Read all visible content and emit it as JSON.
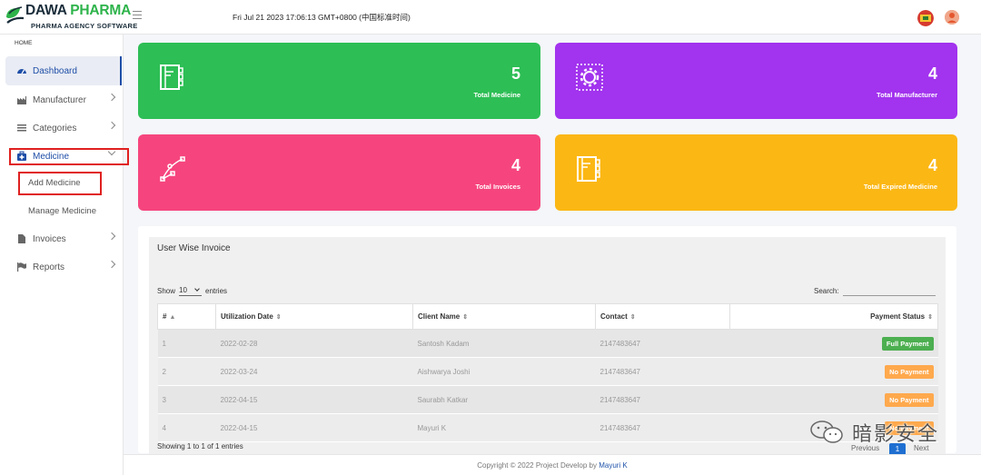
{
  "header": {
    "brand_main": "DAWA",
    "brand_accent": "PHARMA",
    "brand_sub": "PHARMA AGENCY SOFTWARE",
    "datetime": "Fri Jul 21 2023 17:06:13 GMT+0800 (中国标准时间)"
  },
  "sidebar": {
    "home_label": "HOME",
    "items": [
      {
        "label": "Dashboard",
        "icon": "dashboard-icon"
      },
      {
        "label": "Manufacturer",
        "icon": "factory-icon"
      },
      {
        "label": "Categories",
        "icon": "list-icon"
      },
      {
        "label": "Medicine",
        "icon": "medkit-icon"
      },
      {
        "label": "Invoices",
        "icon": "file-icon"
      },
      {
        "label": "Reports",
        "icon": "flag-icon"
      }
    ],
    "medicine_sub": [
      "Add Medicine",
      "Manage Medicine"
    ]
  },
  "cards": [
    {
      "value": "5",
      "label": "Total Medicine",
      "color": "#2dbe55",
      "icon": "notebook-icon"
    },
    {
      "value": "4",
      "label": "Total Manufacturer",
      "color": "#a233ee",
      "icon": "gear-icon"
    },
    {
      "value": "4",
      "label": "Total Invoices",
      "color": "#f6457e",
      "icon": "vector-icon"
    },
    {
      "value": "4",
      "label": "Total Expired Medicine",
      "color": "#fbb714",
      "icon": "notebook-icon"
    }
  ],
  "invoice_table": {
    "title": "User Wise Invoice",
    "show_label": "Show",
    "entries_value": "10",
    "entries_label": "entries",
    "search_label": "Search:",
    "columns": [
      "#",
      "Utilization Date",
      "Client Name",
      "Contact",
      "Payment Status"
    ],
    "rows": [
      {
        "id": "1",
        "date": "2022-02-28",
        "client": "Santosh Kadam",
        "contact": "2147483647",
        "status": "Full Payment",
        "status_color": "#4caf50"
      },
      {
        "id": "2",
        "date": "2022-03-24",
        "client": "Aishwarya Joshi",
        "contact": "2147483647",
        "status": "No Payment",
        "status_color": "#ffa94d"
      },
      {
        "id": "3",
        "date": "2022-04-15",
        "client": "Saurabh Katkar",
        "contact": "2147483647",
        "status": "No Payment",
        "status_color": "#ffa94d"
      },
      {
        "id": "4",
        "date": "2022-04-15",
        "client": "Mayuri K",
        "contact": "2147483647",
        "status": "No Payment",
        "status_color": "#ffa94d"
      }
    ],
    "info": "Showing 1 to 1 of 1 entries",
    "prev": "Previous",
    "page": "1",
    "next": "Next"
  },
  "footer": {
    "text": "Copyright © 2022 Project Develop by",
    "author": "Mayuri K"
  },
  "watermark": "暗影安全"
}
